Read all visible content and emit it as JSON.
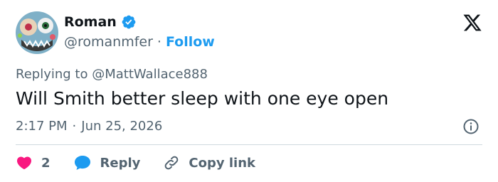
{
  "author": {
    "display_name": "Roman",
    "handle": "@romanmfer",
    "verified": true,
    "follow_label": "Follow",
    "separator": "·"
  },
  "brand": {
    "logo": "x-logo",
    "accent": "#1d9bf0"
  },
  "tweet": {
    "replying_prefix": "Replying to",
    "replying_to": "@MattWallace888",
    "text": "Will Smith better sleep with one eye open",
    "time": "2:17 PM",
    "date": "Jun 25, 2026",
    "separator": "·"
  },
  "actions": {
    "like_count": "2",
    "reply_label": "Reply",
    "copy_label": "Copy link"
  },
  "colors": {
    "like": "#f91880",
    "reply": "#1d9bf0",
    "muted": "#536471",
    "text": "#0f1419",
    "divider": "#cfd9de"
  }
}
